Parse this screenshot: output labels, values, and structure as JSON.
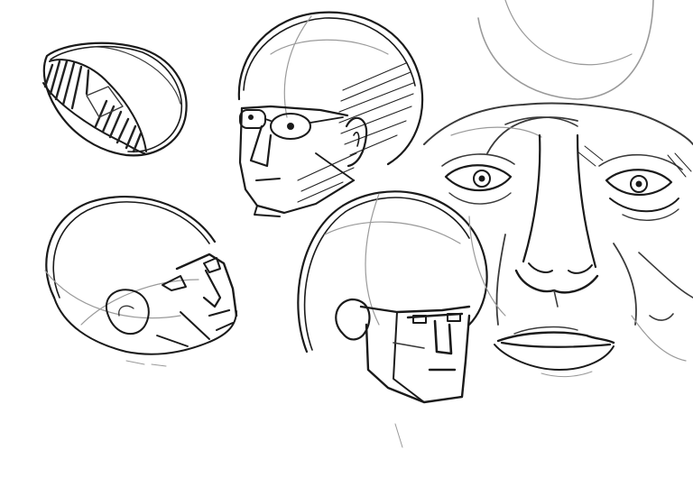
{
  "canvas": {
    "background": "#ffffff",
    "ink_color": "#1a1a1a",
    "light_ink_color": "#9a9a9a"
  },
  "sketches": [
    {
      "name": "cranium-shell-study",
      "kind": "loomis-ball-cross-section"
    },
    {
      "name": "head-front-three-quarter",
      "kind": "planar-head-with-glasses"
    },
    {
      "name": "head-back-three-quarter-tilted",
      "kind": "planar-head-rotated"
    },
    {
      "name": "head-from-below",
      "kind": "planar-head-upshot"
    },
    {
      "name": "face-detailed-study",
      "kind": "realistic-face-eyes-nose-mouth"
    }
  ]
}
